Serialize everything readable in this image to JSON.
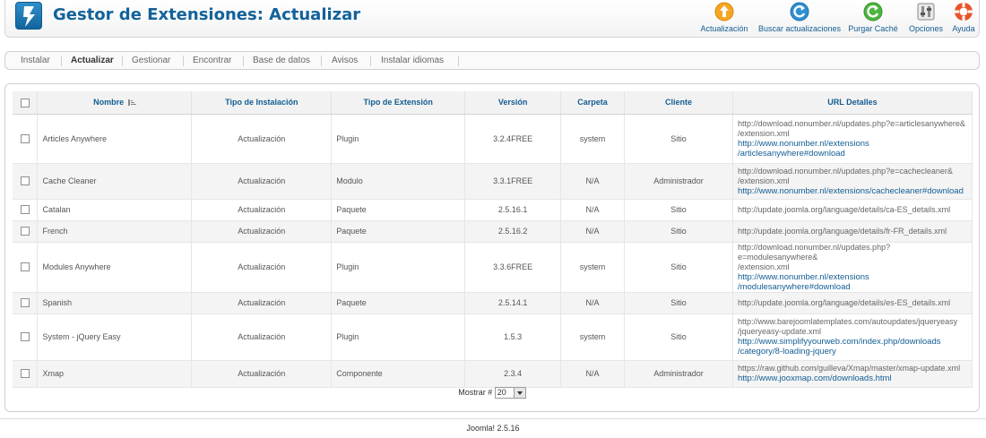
{
  "header": {
    "title": "Gestor de Extensiones: Actualizar",
    "toolbar": [
      {
        "label": "Actualización",
        "icon": "upload-icon"
      },
      {
        "label": "Buscar actualizaciones",
        "icon": "refresh-icon"
      },
      {
        "label": "Purgar Caché",
        "icon": "purge-icon"
      },
      {
        "label": "Opciones",
        "icon": "options-icon"
      },
      {
        "label": "Ayuda",
        "icon": "help-icon"
      }
    ]
  },
  "submenu": {
    "items": [
      "Instalar",
      "Actualizar",
      "Gestionar",
      "Encontrar",
      "Base de datos",
      "Avisos",
      "Instalar idiomas"
    ],
    "active": "Actualizar"
  },
  "table": {
    "columns": [
      "Nombre",
      "Tipo de Instalación",
      "Tipo de Extensión",
      "Versión",
      "Carpeta",
      "Cliente",
      "URL Detalles"
    ],
    "rows": [
      {
        "name": "Articles Anywhere",
        "install": "Actualización",
        "ext": "Plugin",
        "version": "3.2.4FREE",
        "folder": "system",
        "client": "Sitio",
        "url_plain": [
          "http://download.nonumber.nl/updates.php?e=articlesanywhere&",
          "/extension.xml"
        ],
        "url_link": [
          "http://www.nonumber.nl/extensions",
          "/articlesanywhere#download"
        ]
      },
      {
        "name": "Cache Cleaner",
        "install": "Actualización",
        "ext": "Modulo",
        "version": "3.3.1FREE",
        "folder": "N/A",
        "client": "Administrador",
        "url_plain": [
          "http://download.nonumber.nl/updates.php?e=cachecleaner&",
          "/extension.xml"
        ],
        "url_link": [
          "http://www.nonumber.nl/extensions/cachecleaner#download"
        ]
      },
      {
        "name": "Catalan",
        "install": "Actualización",
        "ext": "Paquete",
        "version": "2.5.16.1",
        "folder": "N/A",
        "client": "Sitio",
        "url_plain": [
          "http://update.joomla.org/language/details/ca-ES_details.xml"
        ],
        "url_link": []
      },
      {
        "name": "French",
        "install": "Actualización",
        "ext": "Paquete",
        "version": "2.5.16.2",
        "folder": "N/A",
        "client": "Sitio",
        "url_plain": [
          "http://update.joomla.org/language/details/fr-FR_details.xml"
        ],
        "url_link": []
      },
      {
        "name": "Modules Anywhere",
        "install": "Actualización",
        "ext": "Plugin",
        "version": "3.3.6FREE",
        "folder": "system",
        "client": "Sitio",
        "url_plain": [
          "http://download.nonumber.nl/updates.php?e=modulesanywhere&",
          "/extension.xml"
        ],
        "url_link": [
          "http://www.nonumber.nl/extensions",
          "/modulesanywhere#download"
        ]
      },
      {
        "name": "Spanish",
        "install": "Actualización",
        "ext": "Paquete",
        "version": "2.5.14.1",
        "folder": "N/A",
        "client": "Sitio",
        "url_plain": [
          "http://update.joomla.org/language/details/es-ES_details.xml"
        ],
        "url_link": []
      },
      {
        "name": "System - jQuery Easy",
        "install": "Actualización",
        "ext": "Plugin",
        "version": "1.5.3",
        "folder": "system",
        "client": "Sitio",
        "url_plain": [
          "http://www.barejoomlatemplates.com/autoupdates/jqueryeasy",
          "/jqueryeasy-update.xml"
        ],
        "url_link": [
          "http://www.simplifyyourweb.com/index.php/downloads",
          "/category/8-loading-jquery"
        ]
      },
      {
        "name": "Xmap",
        "install": "Actualización",
        "ext": "Componente",
        "version": "2.3.4",
        "folder": "N/A",
        "client": "Administrador",
        "url_plain": [
          "https://raw.github.com/guilleva/Xmap/master/xmap-update.xml"
        ],
        "url_link": [
          "http://www.jooxmap.com/downloads.html"
        ]
      }
    ]
  },
  "pager": {
    "label": "Mostrar #",
    "value": "20"
  },
  "footer": {
    "text": "Joomla! 2.5.16"
  },
  "colors": {
    "brand": "#13629a",
    "link": "#135d93"
  }
}
